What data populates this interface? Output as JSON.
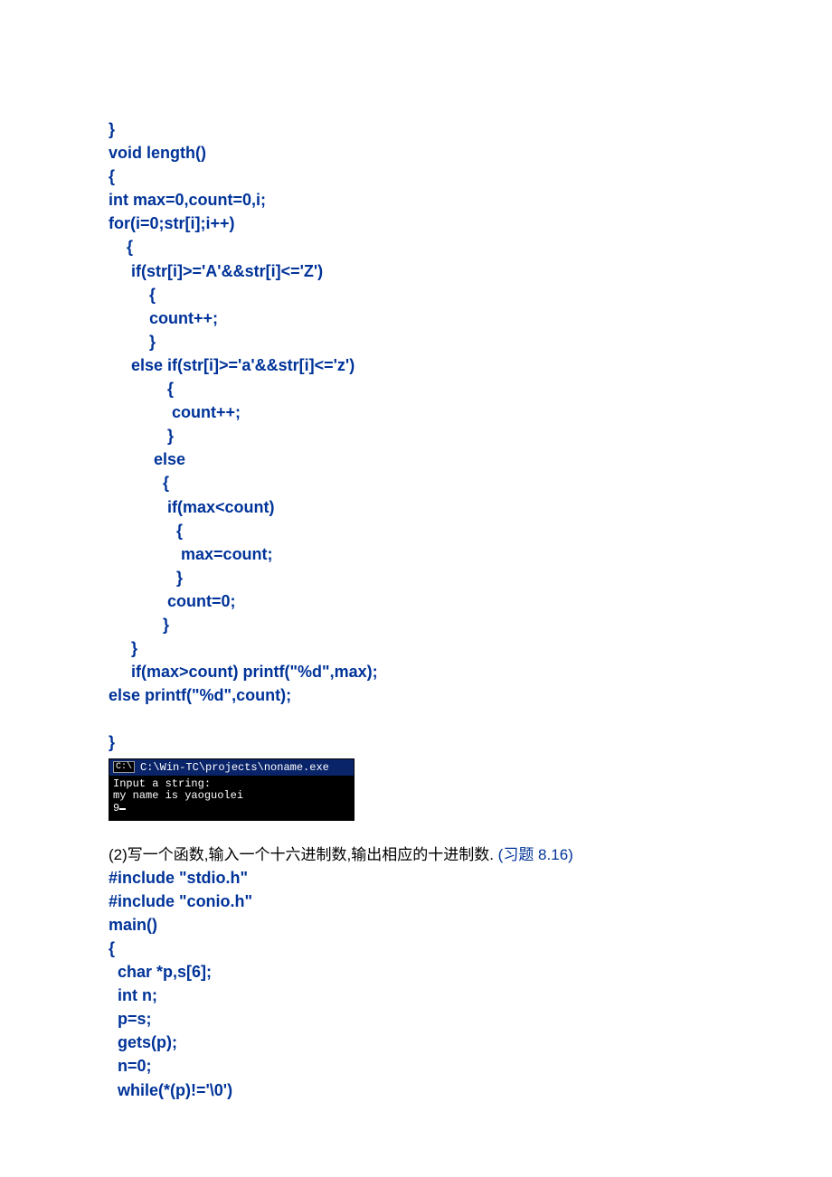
{
  "code1": "}\nvoid length()\n{\nint max=0,count=0,i;\nfor(i=0;str[i];i++)\n    {\n     if(str[i]>='A'&&str[i]<='Z')\n         {\n         count++;\n         }\n     else if(str[i]>='a'&&str[i]<='z')\n             {\n              count++;\n             }\n          else\n            {\n             if(max<count)\n               {\n                max=count;\n               }\n             count=0;\n            }\n     }\n     if(max>count) printf(\"%d\",max);\nelse printf(\"%d\",count);\n\n}",
  "terminal": {
    "icon": "C:\\",
    "title": "C:\\Win-TC\\projects\\noname.exe",
    "line1": "Input a string:",
    "line2": "my name is yaoguolei",
    "line3": "9"
  },
  "problem2": {
    "prefix": "(2)写一个函数,输入一个十六进制数,输出相应的十进制数. ",
    "ref": "(习题 8.16)"
  },
  "code2": "#include \"stdio.h\"\n#include \"conio.h\"\nmain()\n{\n  char *p,s[6];\n  int n;\n  p=s;\n  gets(p);\n  n=0;\n  while(*(p)!='\\0')"
}
